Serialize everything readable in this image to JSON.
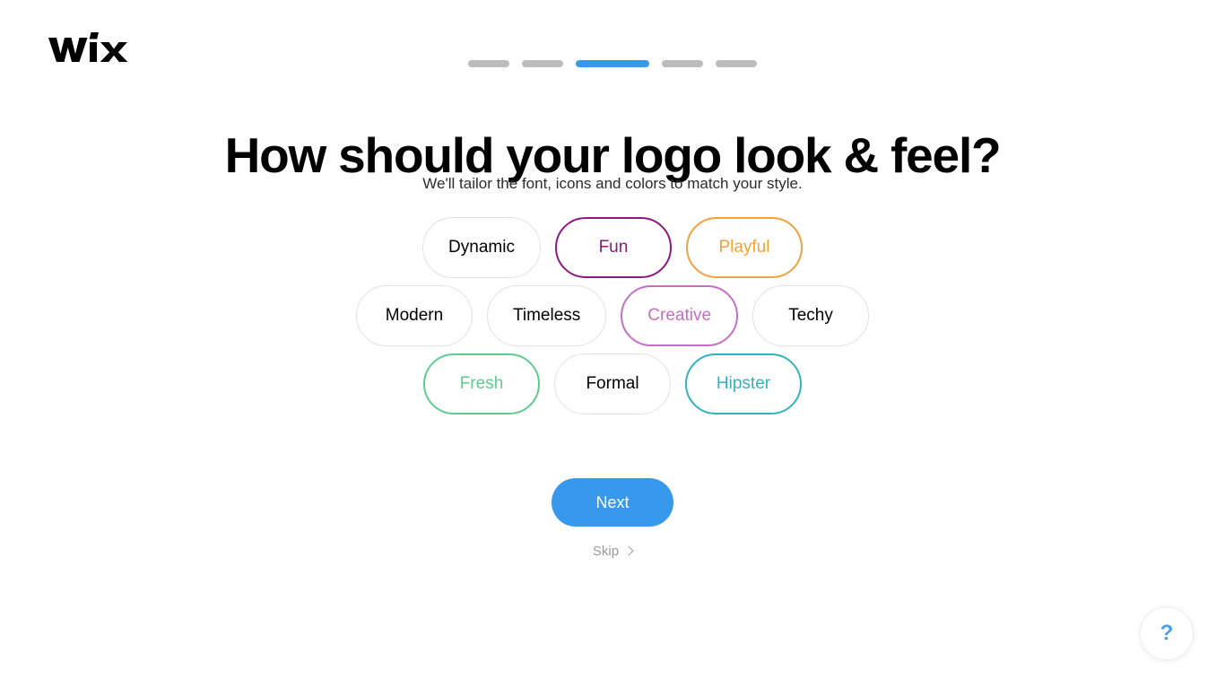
{
  "brand": {
    "logo_name": "wix-logo",
    "logo_text": "WiX"
  },
  "progress": {
    "current_step": 3,
    "total_steps": 5,
    "active_color": "#3899ec",
    "inactive_color": "#bcbcbc",
    "steps": [
      {
        "label": "step-1",
        "active": false
      },
      {
        "label": "step-2",
        "active": false
      },
      {
        "label": "step-3",
        "active": true
      },
      {
        "label": "step-4",
        "active": false
      },
      {
        "label": "step-5",
        "active": false
      }
    ]
  },
  "header": {
    "title": "How should your logo look & feel?",
    "subtitle": "We'll tailor the font, icons and colors to match your style."
  },
  "chips": {
    "rows": [
      [
        {
          "label": "Dynamic",
          "selected": false,
          "color": "#dfe2e5"
        },
        {
          "label": "Fun",
          "selected": true,
          "color": "#8b1a7f"
        },
        {
          "label": "Playful",
          "selected": true,
          "color": "#f0a23c"
        }
      ],
      [
        {
          "label": "Modern",
          "selected": false,
          "color": "#dfe2e5"
        },
        {
          "label": "Timeless",
          "selected": false,
          "color": "#dfe2e5"
        },
        {
          "label": "Creative",
          "selected": true,
          "color": "#c56fc4"
        },
        {
          "label": "Techy",
          "selected": false,
          "color": "#dfe2e5"
        }
      ],
      [
        {
          "label": "Fresh",
          "selected": true,
          "color": "#5fcb8f"
        },
        {
          "label": "Formal",
          "selected": false,
          "color": "#dfe2e5"
        },
        {
          "label": "Hipster",
          "selected": true,
          "color": "#2fb3bf"
        }
      ]
    ]
  },
  "actions": {
    "next_label": "Next",
    "next_color": "#3899ec",
    "skip_label": "Skip",
    "skip_icon": "chevron-right-icon"
  },
  "help": {
    "icon": "question-mark-icon",
    "glyph": "?",
    "color": "#4a9fe8"
  }
}
